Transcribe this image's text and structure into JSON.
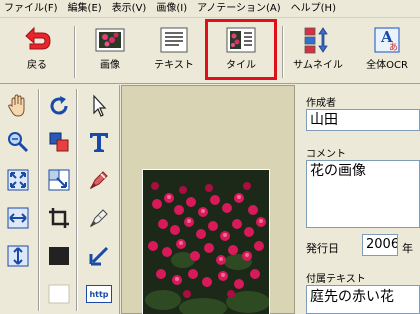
{
  "menu": {
    "items": [
      "ファイル(F)",
      "編集(E)",
      "表示(V)",
      "画像(I)",
      "アノテーション(A)",
      "ヘルプ(H)"
    ]
  },
  "toolbar": {
    "back_label": "戻る",
    "image_label": "画像",
    "text_label": "テキスト",
    "tile_label": "タイル",
    "thumbnail_label": "サムネイル",
    "ocr_label": "全体OCR",
    "highlight_color": "#e0101a"
  },
  "tools": {
    "icons": [
      "hand-icon",
      "rotate-icon",
      "pointer-icon",
      "zoom-icon",
      "copy-region-icon",
      "text-tool-icon",
      "fit-icon",
      "resize-icon",
      "marker-icon",
      "fit-width-icon",
      "crop-icon",
      "eraser-icon",
      "fit-height-icon",
      "black-fill-icon",
      "arrow-icon",
      "white-fill-icon",
      "link-icon"
    ],
    "link_text": "http"
  },
  "form": {
    "author_label": "作成者",
    "author_value": "山田",
    "comment_label": "コメント",
    "comment_value": "花の画像",
    "date_label": "発行日",
    "year_value": "2006",
    "year_unit": "年",
    "attached_label": "付属テキスト",
    "attached_value": "庭先の赤い花"
  },
  "photo": {
    "subject": "flower-photo",
    "accent": "#d81a5a"
  }
}
